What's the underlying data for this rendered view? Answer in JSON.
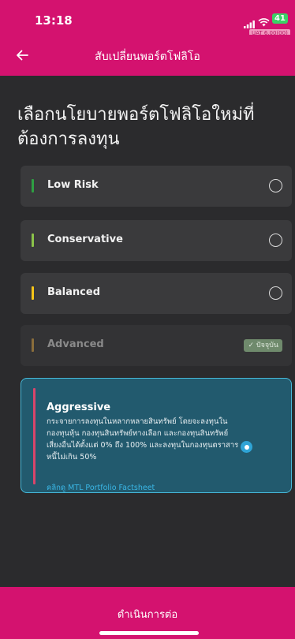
{
  "status": {
    "time": "13:18",
    "battery": "41",
    "env_badge": "UAT 6.00(00)"
  },
  "header": {
    "title": "สับเปลี่ยนพอร์ตโฟลิโอ"
  },
  "page": {
    "heading": "เลือกนโยบายพอร์ตโฟลิโอใหม่ที่ต้องการลงทุน"
  },
  "options": [
    {
      "label": "Low Risk",
      "color": "#2ea043",
      "state": "unselected"
    },
    {
      "label": "Conservative",
      "color": "#8bc34a",
      "state": "unselected"
    },
    {
      "label": "Balanced",
      "color": "#f5c518",
      "state": "unselected"
    },
    {
      "label": "Advanced",
      "color": "#8a6d3b",
      "state": "current",
      "badge": "✓ ปัจจุบัน"
    }
  ],
  "selected": {
    "label": "Aggressive",
    "color": "#d9456b",
    "description": "กระจายการลงทุนในหลากหลายสินทรัพย์ โดยจะลงทุนในกองทุนหุ้น กองทุนสินทรัพย์ทางเลือก และกองทุนสินทรัพย์เสี่ยงอื่นได้ตั้งแต่ 0% ถึง 100% และลงทุนในกองทุนตราสารหนี้ไม่เกิน 50%",
    "link": "คลิกดู MTL Portfolio Factsheet"
  },
  "footer": {
    "continue_label": "ดำเนินการต่อ"
  },
  "colors": {
    "brand": "#d4126f",
    "background": "#2b2b2d",
    "card": "#3a3a3c",
    "selected_card": "#225a6e",
    "selected_border": "#46b8d8",
    "link": "#3ab7e6"
  }
}
